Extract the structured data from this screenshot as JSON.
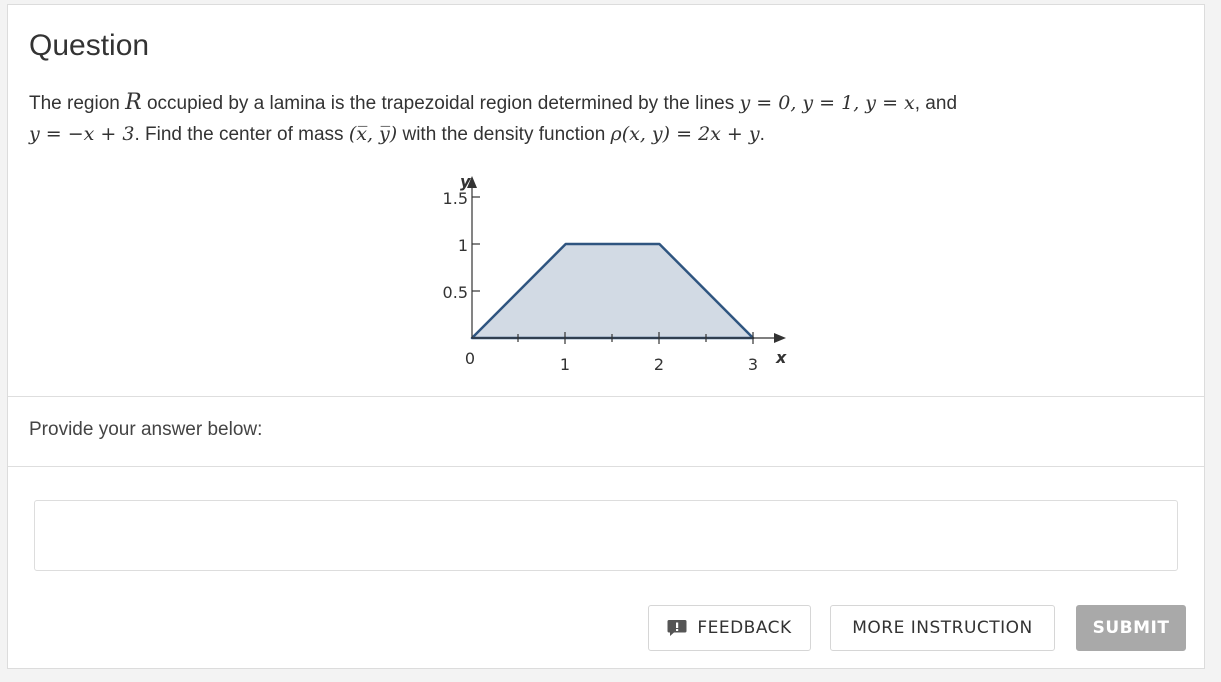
{
  "question": {
    "heading": "Question",
    "text_parts": {
      "p1": "The region ",
      "R": "R",
      "p2": " occupied by a lamina is the trapezoidal region determined by the lines ",
      "m1": "y = 0, y = 1, y = x",
      "p3": ", and",
      "m2": "y = −x + 3",
      "p4": ". Find the center of mass ",
      "m3": "(x̅, y̅)",
      "p5": " with the density function ",
      "m4": "ρ(x, y) = 2x + y",
      "p6": "."
    },
    "graph": {
      "y_axis_label": "y",
      "x_axis_label": "x",
      "y_ticks": [
        "1.5",
        "1",
        "0.5"
      ],
      "x_ticks": [
        "0",
        "1",
        "2",
        "3"
      ],
      "region_vertices": [
        [
          0,
          0
        ],
        [
          1,
          1
        ],
        [
          2,
          1
        ],
        [
          3,
          0
        ]
      ],
      "fill_color": "#d2dae4",
      "edge_color": "#2f5580"
    }
  },
  "answer": {
    "prompt": "Provide your answer below:",
    "value": "",
    "placeholder": ""
  },
  "buttons": {
    "feedback": "FEEDBACK",
    "more_instruction": "MORE INSTRUCTION",
    "submit": "SUBMIT"
  },
  "colors": {
    "submit_bg": "#a9a9a9",
    "feedback_icon": "#555555"
  }
}
